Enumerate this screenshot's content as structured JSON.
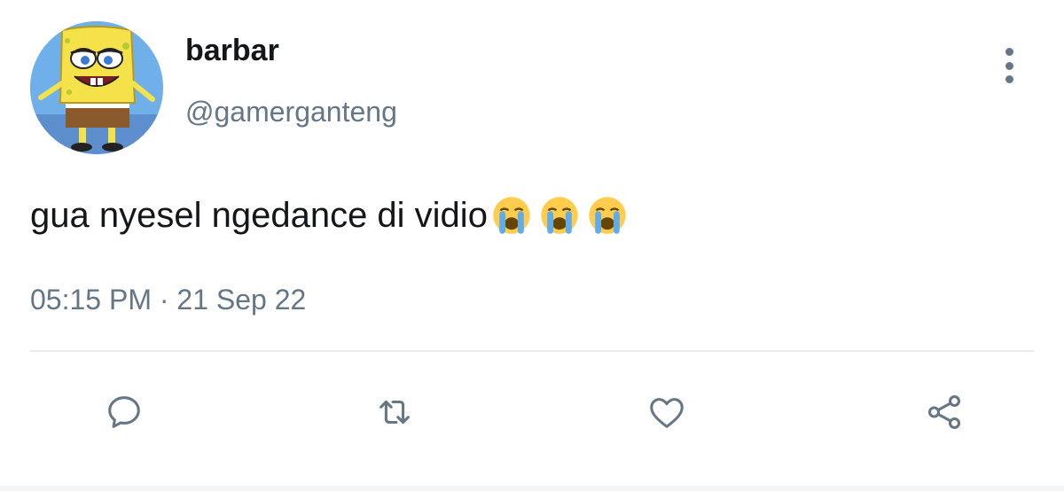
{
  "tweet": {
    "display_name": "barbar",
    "handle": "@gamerganteng",
    "text": "gua nyesel ngedance di vidio",
    "emojis": [
      "loudly-crying-face",
      "loudly-crying-face",
      "loudly-crying-face"
    ],
    "time": "05:15 PM",
    "separator": "·",
    "date": "21 Sep 22"
  },
  "actions": [
    {
      "name": "reply",
      "icon": "comment-icon"
    },
    {
      "name": "retweet",
      "icon": "retweet-icon"
    },
    {
      "name": "like",
      "icon": "heart-icon"
    },
    {
      "name": "share",
      "icon": "share-icon"
    }
  ],
  "colors": {
    "text": "#14171a",
    "secondary": "#657786",
    "divider": "#e6ecf0",
    "avatar_bg": "#6fb0ea"
  }
}
